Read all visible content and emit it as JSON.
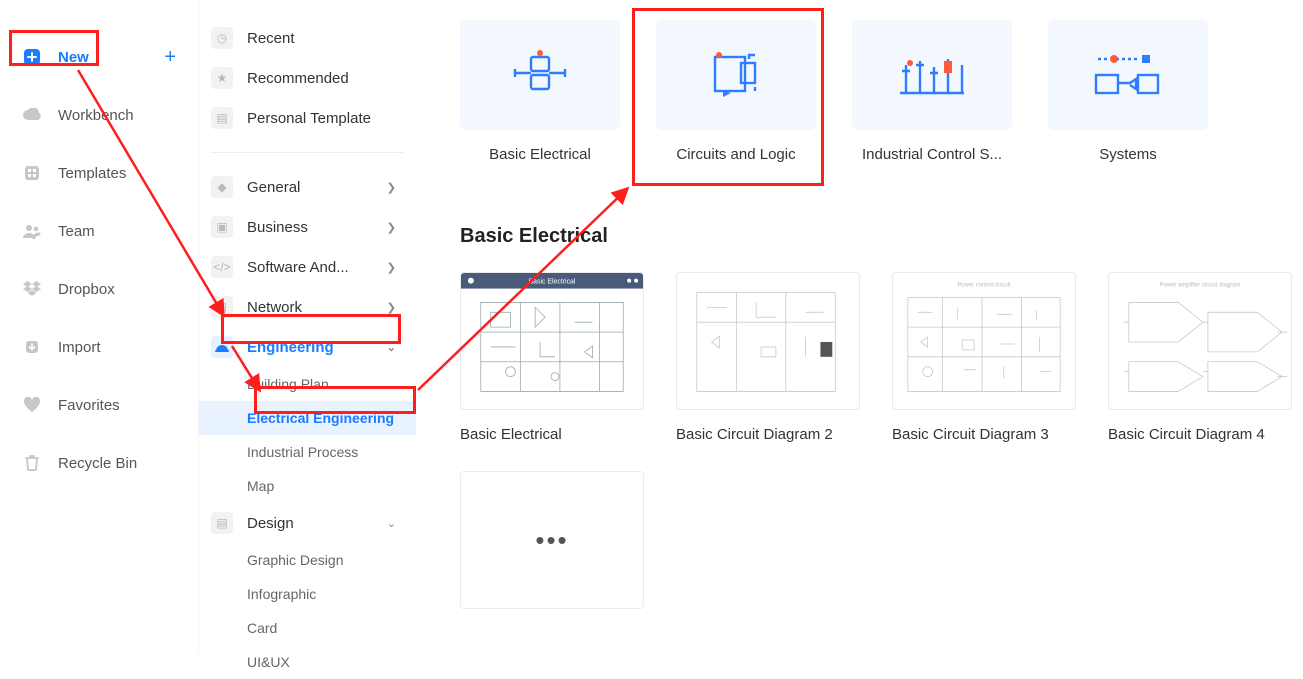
{
  "nav": {
    "items": [
      {
        "label": "New",
        "icon": "plus-square-icon",
        "active": true,
        "plus": true
      },
      {
        "label": "Workbench",
        "icon": "cloud-icon"
      },
      {
        "label": "Templates",
        "icon": "grid-icon"
      },
      {
        "label": "Team",
        "icon": "people-icon"
      },
      {
        "label": "Dropbox",
        "icon": "dropbox-icon"
      },
      {
        "label": "Import",
        "icon": "import-icon"
      },
      {
        "label": "Favorites",
        "icon": "heart-icon"
      },
      {
        "label": "Recycle Bin",
        "icon": "trash-icon"
      }
    ]
  },
  "categories": {
    "top": [
      {
        "label": "Recent",
        "icon": "clock-icon"
      },
      {
        "label": "Recommended",
        "icon": "star-icon"
      },
      {
        "label": "Personal Template",
        "icon": "template-icon"
      }
    ],
    "groups": [
      {
        "label": "General",
        "icon": "tag-icon",
        "chevron": "right"
      },
      {
        "label": "Business",
        "icon": "business-icon",
        "chevron": "right"
      },
      {
        "label": "Software And...",
        "icon": "code-icon",
        "chevron": "right"
      },
      {
        "label": "Network",
        "icon": "network-icon",
        "chevron": "right"
      },
      {
        "label": "Engineering",
        "icon": "helmet-icon",
        "chevron": "down",
        "selected": true,
        "subs": [
          {
            "label": "Building Plan"
          },
          {
            "label": "Electrical Engineering",
            "selected": true
          },
          {
            "label": "Industrial Process"
          },
          {
            "label": "Map"
          }
        ]
      },
      {
        "label": "Design",
        "icon": "design-icon",
        "chevron": "down",
        "subs": [
          {
            "label": "Graphic Design"
          },
          {
            "label": "Infographic"
          },
          {
            "label": "Card"
          },
          {
            "label": "UI&UX"
          }
        ]
      }
    ]
  },
  "main": {
    "tiles": [
      {
        "label": "Basic Electrical",
        "icon": "basic-electrical-icon"
      },
      {
        "label": "Circuits and Logic",
        "icon": "circuits-logic-icon"
      },
      {
        "label": "Industrial Control S...",
        "icon": "industrial-control-icon"
      },
      {
        "label": "Systems",
        "icon": "systems-icon"
      }
    ],
    "section_title": "Basic Electrical",
    "templates": [
      {
        "label": "Basic Electrical",
        "thumb": "tpl-basic-electrical"
      },
      {
        "label": "Basic Circuit Diagram 2",
        "thumb": "tpl-circuit-2"
      },
      {
        "label": "Basic Circuit Diagram 3",
        "thumb": "tpl-circuit-3"
      },
      {
        "label": "Basic Circuit Diagram 4",
        "thumb": "tpl-circuit-4"
      }
    ],
    "more_label": "•••"
  }
}
